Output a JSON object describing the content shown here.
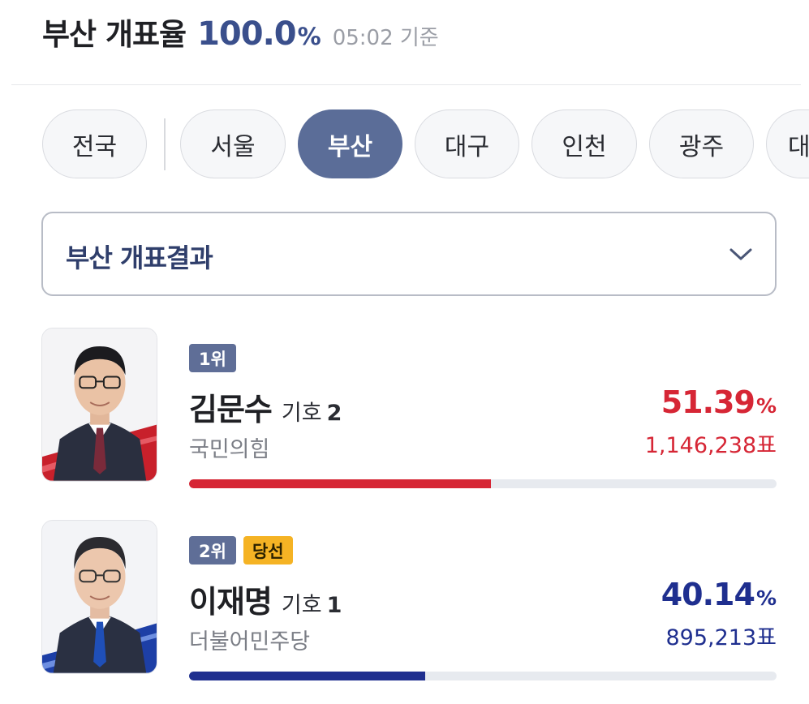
{
  "header": {
    "title": "부산 개표율",
    "rate": "100.0",
    "rate_unit": "%",
    "time": "05:02 기준",
    "rate_color": "#3a4f8c"
  },
  "tabs": [
    {
      "label": "전국",
      "active": false
    },
    {
      "label": "서울",
      "active": false
    },
    {
      "label": "부산",
      "active": true
    },
    {
      "label": "대구",
      "active": false
    },
    {
      "label": "인천",
      "active": false
    },
    {
      "label": "광주",
      "active": false
    },
    {
      "label": "대",
      "active": false
    }
  ],
  "dropdown": {
    "label": "부산 개표결과",
    "icon": "chevron-down-icon"
  },
  "candidates": [
    {
      "rank": "1위",
      "winner": false,
      "winner_label": "",
      "name": "김문수",
      "number_label": "기호",
      "number": "2",
      "party": "국민의힘",
      "percent": "51.39",
      "percent_unit": "%",
      "votes": "1,146,238",
      "votes_unit": "표",
      "share": 0.5139,
      "color": "#d62635"
    },
    {
      "rank": "2위",
      "winner": true,
      "winner_label": "당선",
      "name": "이재명",
      "number_label": "기호",
      "number": "1",
      "party": "더불어민주당",
      "percent": "40.14",
      "percent_unit": "%",
      "votes": "895,213",
      "votes_unit": "표",
      "share": 0.4014,
      "color": "#1f2f8f"
    }
  ]
}
